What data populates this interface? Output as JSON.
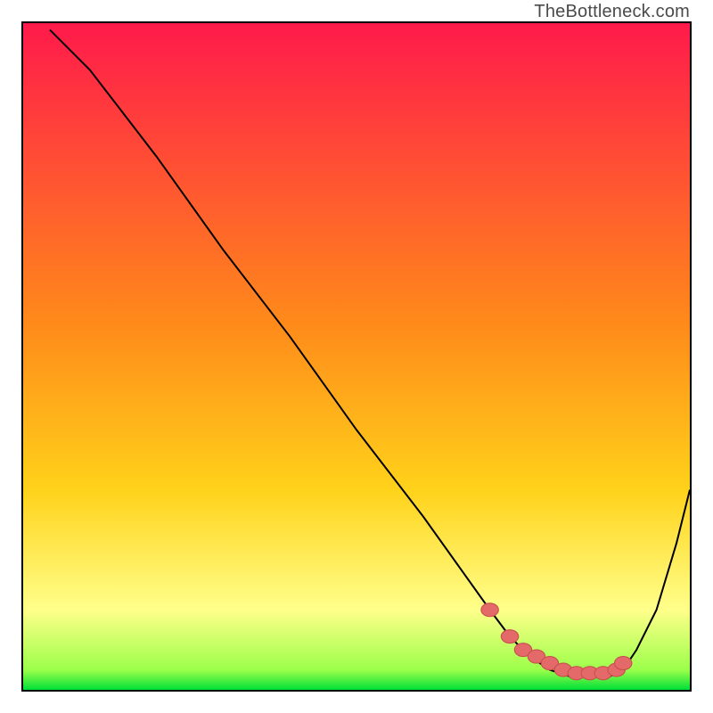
{
  "watermark": "TheBottleneck.com",
  "colors": {
    "gradient_top": "#ff1a4b",
    "gradient_mid": "#ffd21a",
    "gradient_low": "#ffff8a",
    "gradient_bottom": "#00e038",
    "curve": "#000000",
    "marker_fill": "#e46a6a",
    "marker_stroke": "#c94f4f",
    "frame": "#000000"
  },
  "chart_data": {
    "type": "line",
    "title": "",
    "xlabel": "",
    "ylabel": "",
    "xlim": [
      0,
      100
    ],
    "ylim": [
      0,
      100
    ],
    "grid": false,
    "legend": false,
    "series": [
      {
        "name": "bottleneck-curve",
        "x": [
          4,
          10,
          20,
          30,
          40,
          50,
          60,
          65,
          70,
          73,
          76,
          79,
          82,
          85,
          88,
          90,
          92,
          95,
          98,
          100
        ],
        "values": [
          99,
          93,
          80,
          66,
          53,
          39,
          26,
          19,
          12,
          8,
          5,
          3,
          2,
          2,
          2,
          3,
          6,
          12,
          22,
          30
        ]
      }
    ],
    "markers": {
      "name": "highlighted-range",
      "x": [
        70,
        73,
        75,
        77,
        79,
        81,
        83,
        85,
        87,
        89,
        90
      ],
      "values": [
        12,
        8,
        6,
        5,
        4,
        3,
        2.5,
        2.5,
        2.5,
        3,
        4
      ]
    }
  }
}
